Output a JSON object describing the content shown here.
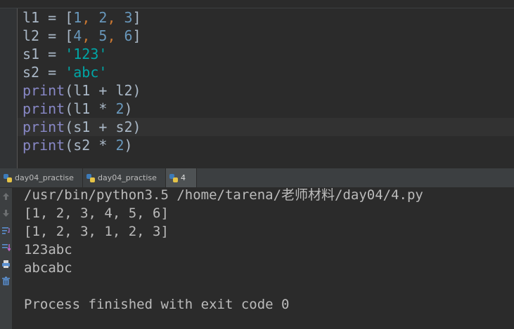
{
  "editor": {
    "lines": [
      {
        "var": "l1",
        "op": " = ",
        "open": "[",
        "items": [
          "1",
          "2",
          "3"
        ],
        "close": "]"
      },
      {
        "var": "l2",
        "op": " = ",
        "open": "[",
        "items": [
          "4",
          "5",
          "6"
        ],
        "close": "]"
      },
      {
        "var": "s1",
        "op": " = ",
        "str": "'123'"
      },
      {
        "var": "s2",
        "op": " = ",
        "str": "'abc'"
      },
      {
        "fn": "print",
        "args": "(l1 + l2)"
      },
      {
        "fn": "print",
        "args_pre": "(l1 * ",
        "num": "2",
        "args_post": ")"
      },
      {
        "fn": "print",
        "args": "(s1 + s2)"
      },
      {
        "fn": "print",
        "args_pre": "(s2 * ",
        "num": "2",
        "args_post": ")"
      }
    ],
    "comma": ", "
  },
  "run_tabs": [
    {
      "label": "day04_practise"
    },
    {
      "label": "day04_practise"
    },
    {
      "label": "4"
    }
  ],
  "console": {
    "output": [
      "/usr/bin/python3.5 /home/tarena/老师材料/day04/4.py",
      "[1, 2, 3, 4, 5, 6]",
      "[1, 2, 3, 1, 2, 3]",
      "123abc",
      "abcabc",
      "",
      "Process finished with exit code 0"
    ],
    "tools": [
      "arrow-up-icon",
      "arrow-down-icon",
      "soft-wrap-icon",
      "scroll-to-end-icon",
      "print-icon",
      "trash-icon"
    ]
  },
  "colors": {
    "background": "#2b2b2b",
    "number": "#6897bb",
    "string": "#00a6a6",
    "keyword": "#cc7832",
    "builtin": "#8888c6",
    "text": "#a9b7c6"
  }
}
